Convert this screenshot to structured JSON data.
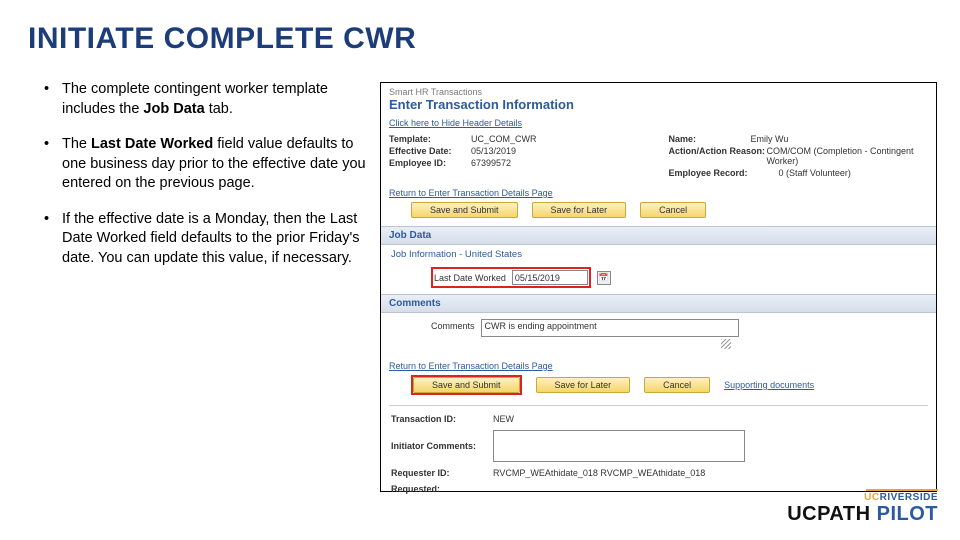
{
  "title": "INITIATE COMPLETE CWR",
  "bullets": {
    "b1a": "The complete contingent worker template includes the ",
    "b1b": "Job Data",
    "b1c": " tab.",
    "b2a": "The ",
    "b2b": "Last Date Worked",
    "b2c": " field value defaults to one business day prior to the effective date you entered on the previous page.",
    "b3": "If the effective date is a Monday, then the Last Date Worked field defaults to the prior Friday's date. You can update this value, if necessary."
  },
  "screenshot": {
    "breadcrumb": "Smart HR Transactions",
    "page_title": "Enter Transaction Information",
    "hide_link": "Click here to Hide Header Details",
    "details_left": {
      "template_lbl": "Template:",
      "template_val": "UC_COM_CWR",
      "effdate_lbl": "Effective Date:",
      "effdate_val": "05/13/2019",
      "emplid_lbl": "Employee ID:",
      "emplid_val": "67399572"
    },
    "details_right": {
      "name_lbl": "Name:",
      "name_val": "Emily Wu",
      "action_lbl": "Action/Action Reason:",
      "action_val": "COM/COM (Completion - Contingent Worker)",
      "record_lbl": "Employee Record:",
      "record_val": "0 (Staff Volunteer)"
    },
    "return_link": "Return to Enter Transaction Details Page",
    "btn_save_submit": "Save and Submit",
    "btn_save_later": "Save for Later",
    "btn_cancel": "Cancel",
    "section_jobdata": "Job Data",
    "subsection_jobinfo": "Job Information - United States",
    "last_date_worked_lbl": "Last Date Worked",
    "last_date_worked_val": "05/15/2019",
    "section_comments": "Comments",
    "comments_lbl": "Comments",
    "comments_val": "CWR is ending appointment",
    "return_link2": "Return to Enter Transaction Details Page",
    "support_link": "Supporting documents",
    "txid_lbl": "Transaction ID:",
    "txid_val": "NEW",
    "initcomm_lbl": "Initiator Comments:",
    "reqid_lbl": "Requester ID:",
    "reqid_val": "RVCMP_WEAthidate_018   RVCMP_WEAthidate_018",
    "requested_lbl": "Requested:"
  },
  "logo": {
    "uc_u": "UC",
    "uc_r": "RIVERSIDE",
    "main1": "UCPATH ",
    "main2": "PILOT"
  }
}
